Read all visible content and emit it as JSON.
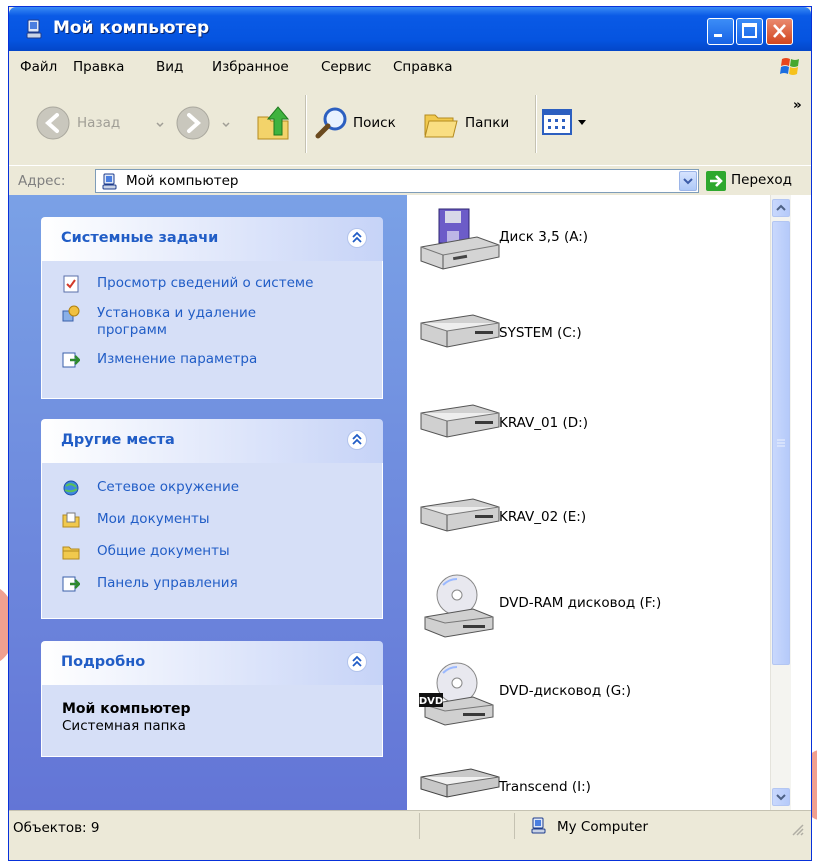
{
  "window": {
    "title": "Мой компьютер",
    "colors": {
      "titlebar": "#0554e0",
      "taskpane": "#6f8ddf",
      "panel_text": "#215dc6",
      "go_green": "#2ea82e"
    }
  },
  "menu": {
    "items": [
      "Файл",
      "Правка",
      "Вид",
      "Избранное",
      "Сервис",
      "Справка"
    ]
  },
  "toolbar": {
    "back_label": "Назад",
    "search_label": "Поиск",
    "folders_label": "Папки",
    "more_glyph": "»"
  },
  "address": {
    "label": "Адрес:",
    "value": "Мой компьютер",
    "go_label": "Переход"
  },
  "panels": {
    "system_tasks": {
      "title": "Системные задачи",
      "items": [
        {
          "label": "Просмотр сведений о системе",
          "icon": "system-info-icon"
        },
        {
          "label": "Установка и удаление",
          "label2": "программ",
          "icon": "add-remove-programs-icon"
        },
        {
          "label": "Изменение параметра",
          "icon": "control-panel-icon"
        }
      ]
    },
    "other_places": {
      "title": "Другие места",
      "items": [
        {
          "label": "Сетевое окружение",
          "icon": "network-icon"
        },
        {
          "label": "Мои документы",
          "icon": "my-documents-icon"
        },
        {
          "label": "Общие документы",
          "icon": "shared-documents-icon"
        },
        {
          "label": "Панель управления",
          "icon": "control-panel-icon"
        }
      ]
    },
    "details": {
      "title": "Подробно",
      "name": "Мой компьютер",
      "type": "Системная папка"
    }
  },
  "drives": [
    {
      "label": "Диск 3,5 (A:)",
      "icon": "floppy-drive-icon"
    },
    {
      "label": "SYSTEM (C:)",
      "icon": "hard-drive-icon"
    },
    {
      "label": "KRAV_01 (D:)",
      "icon": "hard-drive-icon"
    },
    {
      "label": "KRAV_02 (E:)",
      "icon": "hard-drive-icon"
    },
    {
      "label": "DVD-RAM дисковод (F:)",
      "icon": "dvd-ram-drive-icon"
    },
    {
      "label": "DVD-дисковод (G:)",
      "icon": "dvd-drive-icon",
      "badge": "DVD"
    },
    {
      "label": "Transcend (I:)",
      "icon": "removable-drive-icon"
    }
  ],
  "status": {
    "objects": "Объектов: 9",
    "location": "My Computer"
  }
}
